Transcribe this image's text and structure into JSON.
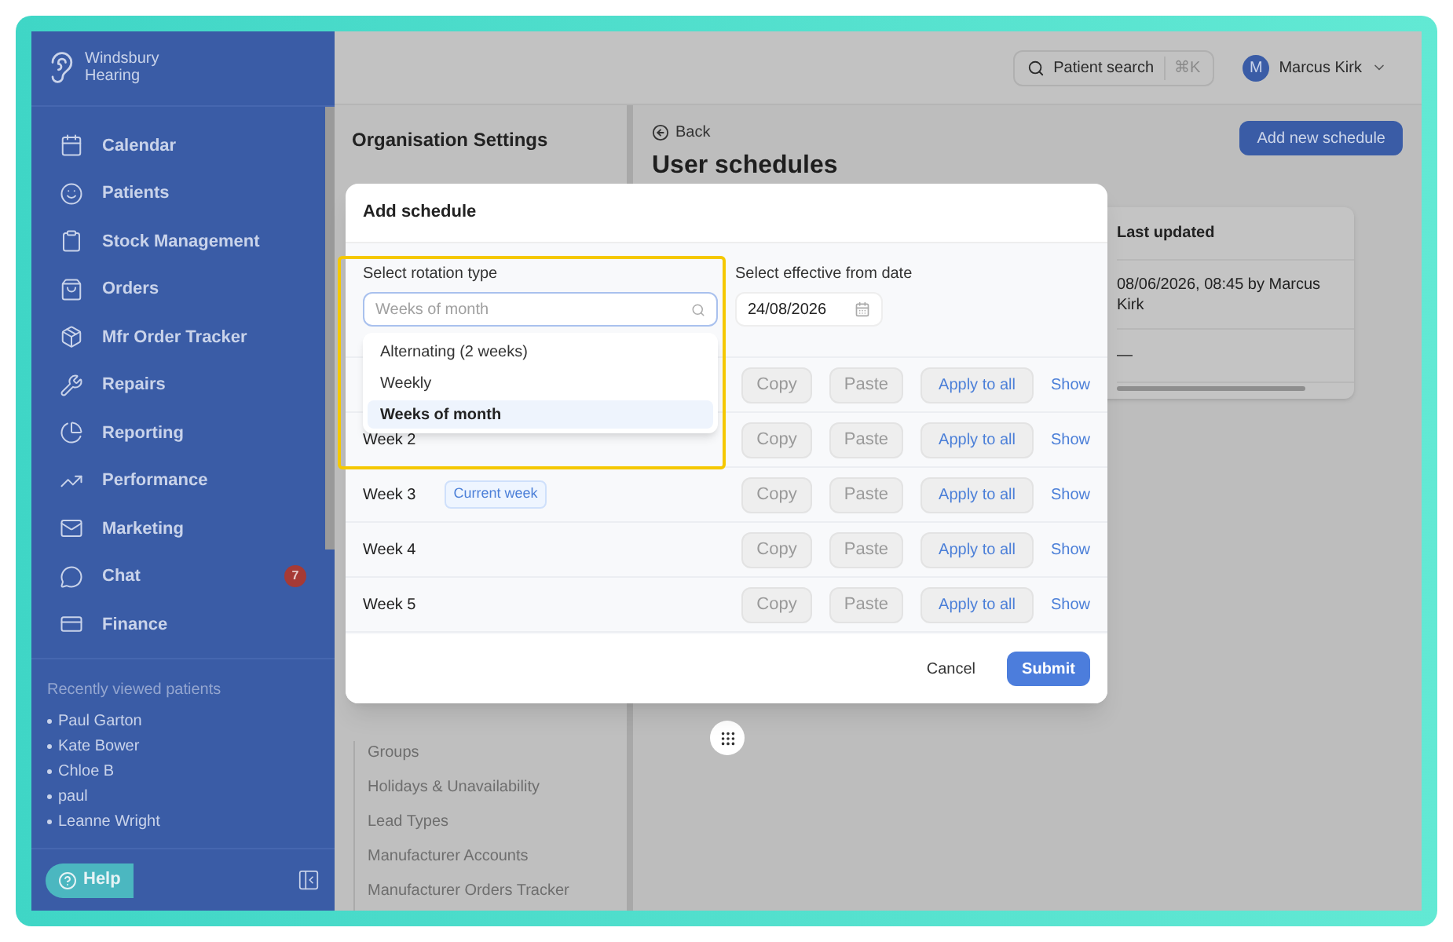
{
  "brand": {
    "lines": [
      "Windsbury",
      "Hearing"
    ]
  },
  "nav": [
    {
      "label": "Calendar"
    },
    {
      "label": "Patients"
    },
    {
      "label": "Stock Management"
    },
    {
      "label": "Orders"
    },
    {
      "label": "Mfr Order Tracker"
    },
    {
      "label": "Repairs"
    },
    {
      "label": "Reporting"
    },
    {
      "label": "Performance"
    },
    {
      "label": "Marketing"
    },
    {
      "label": "Chat",
      "badge": "7"
    },
    {
      "label": "Finance"
    }
  ],
  "recent": {
    "title": "Recently viewed patients",
    "patients": [
      "Paul Garton",
      "Kate Bower",
      "Chloe B",
      "paul",
      "Leanne Wright"
    ]
  },
  "help_button": "Help",
  "header": {
    "search": {
      "label": "Patient search",
      "shortcut": "⌘K"
    },
    "user": {
      "initial": "M",
      "name": "Marcus Kirk"
    }
  },
  "settings_panel": {
    "title": "Organisation Settings",
    "items": [
      "Groups",
      "Holidays & Unavailability",
      "Lead Types",
      "Manufacturer Accounts",
      "Manufacturer Orders Tracker"
    ]
  },
  "page": {
    "back": "Back",
    "title": "User schedules",
    "add_button": "Add new schedule",
    "table": {
      "column_2": "Last updated",
      "rows": [
        {
          "last_updated": "08/06/2026, 08:45 by Marcus Kirk"
        },
        {
          "last_updated": "—"
        }
      ]
    }
  },
  "modal": {
    "title": "Add schedule",
    "rotation": {
      "label": "Select rotation type",
      "placeholder": "Weeks of month",
      "expanded": true,
      "options": [
        {
          "label": "Alternating (2 weeks)",
          "selected": false
        },
        {
          "label": "Weekly",
          "selected": false
        },
        {
          "label": "Weeks of month",
          "selected": true
        }
      ]
    },
    "date": {
      "label": "Select effective from date",
      "value": "24/08/2026"
    },
    "weeks": [
      {
        "copy": {
          "label": "Copy",
          "disabled": true
        },
        "paste": {
          "label": "Paste",
          "disabled": true
        },
        "apply": "Apply to all",
        "show": "Show"
      },
      {
        "label": "Week 2",
        "copy": {
          "label": "Copy",
          "disabled": true
        },
        "paste": {
          "label": "Paste",
          "disabled": true
        },
        "apply": "Apply to all",
        "show": "Show"
      },
      {
        "label": "Week 3",
        "badge": "Current week",
        "copy": {
          "label": "Copy",
          "disabled": true
        },
        "paste": {
          "label": "Paste",
          "disabled": true
        },
        "apply": "Apply to all",
        "show": "Show"
      },
      {
        "label": "Week 4",
        "copy": {
          "label": "Copy",
          "disabled": true
        },
        "paste": {
          "label": "Paste",
          "disabled": true
        },
        "apply": "Apply to all",
        "show": "Show"
      },
      {
        "label": "Week 5",
        "copy": {
          "label": "Copy",
          "disabled": true
        },
        "paste": {
          "label": "Paste",
          "disabled": true
        },
        "apply": "Apply to all",
        "show": "Show"
      }
    ],
    "cancel": "Cancel",
    "submit": "Submit"
  }
}
